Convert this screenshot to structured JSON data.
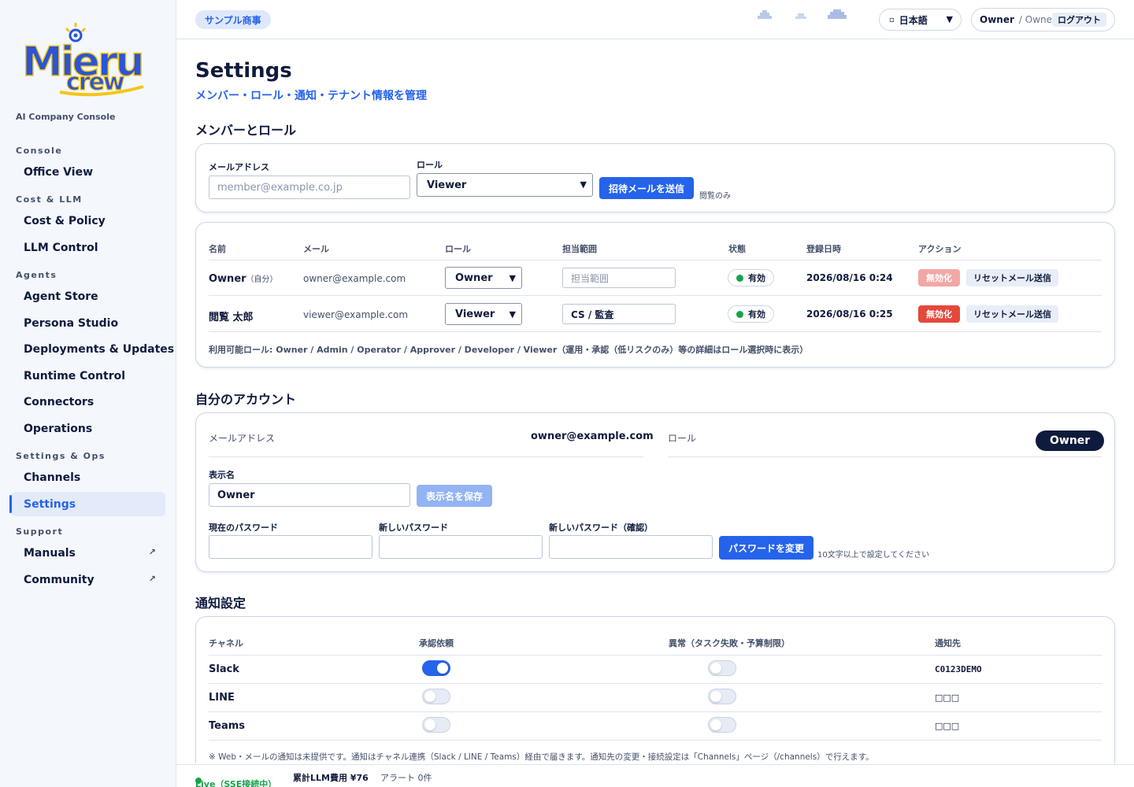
{
  "sidebar": {
    "logo_text": "Mieru crew",
    "tagline": "AI Company Console",
    "sections": [
      {
        "title": "Console",
        "items": [
          {
            "label": "Office View"
          }
        ]
      },
      {
        "title": "Cost & LLM",
        "items": [
          {
            "label": "Cost & Policy"
          },
          {
            "label": "LLM Control"
          }
        ]
      },
      {
        "title": "Agents",
        "items": [
          {
            "label": "Agent Store"
          },
          {
            "label": "Persona Studio"
          },
          {
            "label": "Deployments & Updates"
          },
          {
            "label": "Runtime Control"
          },
          {
            "label": "Connectors"
          },
          {
            "label": "Operations"
          }
        ]
      },
      {
        "title": "Settings & Ops",
        "items": [
          {
            "label": "Channels"
          },
          {
            "label": "Settings",
            "active": true
          }
        ]
      },
      {
        "title": "Support",
        "items": [
          {
            "label": "Manuals",
            "external": "↗"
          },
          {
            "label": "Community",
            "external": "↗"
          }
        ]
      }
    ]
  },
  "topbar": {
    "tenant": "サンプル商事",
    "language": "日本語",
    "user_name": "Owner",
    "user_role": "/ Owner",
    "logout": "ログアウト"
  },
  "page": {
    "title": "Settings",
    "subtitle": "メンバー・ロール・通知・テナント情報を管理"
  },
  "members": {
    "heading": "メンバーとロール",
    "invite": {
      "email_label": "メールアドレス",
      "email_placeholder": "member@example.co.jp",
      "role_label": "ロール",
      "role_value": "Viewer",
      "send_button": "招待メールを送信",
      "role_hint": "閲覧のみ"
    },
    "columns": [
      "名前",
      "メール",
      "ロール",
      "担当範囲",
      "状態",
      "登録日時",
      "アクション"
    ],
    "rows": [
      {
        "name": "Owner",
        "self_tag": "（自分）",
        "email": "owner@example.com",
        "role": "Owner",
        "scope": "",
        "scope_placeholder": "担当範囲",
        "status": "有効",
        "registered": "2026/08/16 0:24",
        "disable": "無効化",
        "reset": "リセットメール送信"
      },
      {
        "name": "閲覧 太郎",
        "self_tag": "",
        "email": "viewer@example.com",
        "role": "Viewer",
        "scope": "CS / 監査",
        "scope_placeholder": "",
        "status": "有効",
        "registered": "2026/08/16 0:25",
        "disable": "無効化",
        "reset": "リセットメール送信"
      }
    ],
    "footnote": "利用可能ロール: Owner / Admin / Operator / Approver / Developer / Viewer（運用・承認（低リスクのみ）等の詳細はロール選択時に表示）"
  },
  "account": {
    "heading": "自分のアカウント",
    "email_label": "メールアドレス",
    "email_value": "owner@example.com",
    "role_label": "ロール",
    "role_value": "Owner",
    "display_name_label": "表示名",
    "display_name_value": "Owner",
    "save_display_name": "表示名を保存",
    "current_password_label": "現在のパスワード",
    "new_password_label": "新しいパスワード",
    "confirm_password_label": "新しいパスワード（確認）",
    "change_password": "パスワードを変更",
    "password_hint": "10文字以上で設定してください"
  },
  "notifications": {
    "heading": "通知設定",
    "columns": [
      "チャネル",
      "承認依頼",
      "異常（タスク失敗・予算制限）",
      "通知先"
    ],
    "rows": [
      {
        "channel": "Slack",
        "approval": true,
        "anomaly": false,
        "destination": "C0123DEMO"
      },
      {
        "channel": "LINE",
        "approval": false,
        "anomaly": false,
        "destination": "□□□"
      },
      {
        "channel": "Teams",
        "approval": false,
        "anomaly": false,
        "destination": "□□□"
      }
    ],
    "footnote": "※ Web・メールの通知は未提供です。通知はチャネル連携（Slack / LINE / Teams）経由で届きます。通知先の変更・接続設定は「Channels」ページ（/channels）で行えます。"
  },
  "footer": {
    "live": "Live（SSE接続中）",
    "cost": "累計LLM費用 ¥76",
    "alerts": "アラート 0件"
  },
  "colors": {
    "accent": "#2563eb",
    "navy": "#0f1b3d",
    "live_green": "#16a34a",
    "danger": "#e5483b"
  }
}
